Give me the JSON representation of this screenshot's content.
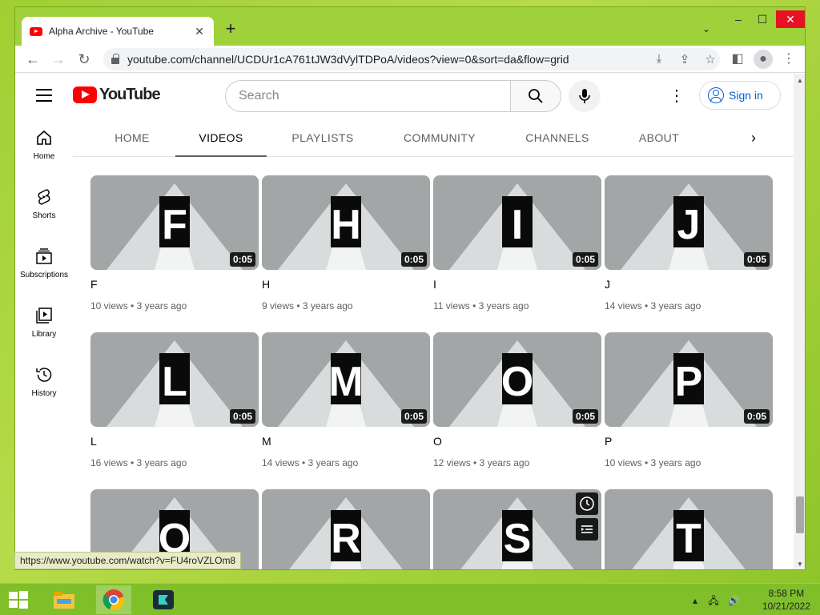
{
  "browser": {
    "tab_title": "Alpha Archive - YouTube",
    "url": "youtube.com/channel/UCDUr1cA761tJW3dVylTDPoA/videos?view=0&sort=da&flow=grid",
    "status_url": "https://www.youtube.com/watch?v=FU4roVZLOm8"
  },
  "youtube": {
    "logo_text": "YouTube",
    "search_placeholder": "Search",
    "sign_in": "Sign in",
    "guide": [
      {
        "label": "Home",
        "icon": "home-icon"
      },
      {
        "label": "Shorts",
        "icon": "shorts-icon"
      },
      {
        "label": "Subscriptions",
        "icon": "subscriptions-icon"
      },
      {
        "label": "Library",
        "icon": "library-icon"
      },
      {
        "label": "History",
        "icon": "history-icon"
      }
    ],
    "tabs": [
      "HOME",
      "VIDEOS",
      "PLAYLISTS",
      "COMMUNITY",
      "CHANNELS",
      "ABOUT"
    ],
    "active_tab": "VIDEOS",
    "videos": [
      {
        "letter": "F",
        "title": "F",
        "duration": "0:05",
        "views": "10 views",
        "age": "3 years ago"
      },
      {
        "letter": "H",
        "title": "H",
        "duration": "0:05",
        "views": "9 views",
        "age": "3 years ago"
      },
      {
        "letter": "I",
        "title": "I",
        "duration": "0:05",
        "views": "11 views",
        "age": "3 years ago"
      },
      {
        "letter": "J",
        "title": "J",
        "duration": "0:05",
        "views": "14 views",
        "age": "3 years ago"
      },
      {
        "letter": "L",
        "title": "L",
        "duration": "0:05",
        "views": "16 views",
        "age": "3 years ago"
      },
      {
        "letter": "M",
        "title": "M",
        "duration": "0:05",
        "views": "14 views",
        "age": "3 years ago"
      },
      {
        "letter": "O",
        "title": "O",
        "duration": "0:05",
        "views": "12 views",
        "age": "3 years ago"
      },
      {
        "letter": "P",
        "title": "P",
        "duration": "0:05",
        "views": "10 views",
        "age": "3 years ago"
      },
      {
        "letter": "Q",
        "title": "",
        "duration": "",
        "views": "",
        "age": ""
      },
      {
        "letter": "R",
        "title": "",
        "duration": "",
        "views": "",
        "age": ""
      },
      {
        "letter": "S",
        "title": "",
        "duration": "",
        "views": "",
        "age": ""
      },
      {
        "letter": "T",
        "title": "",
        "duration": "",
        "views": "",
        "age": ""
      }
    ]
  },
  "taskbar": {
    "time": "8:58 PM",
    "date": "10/21/2022"
  },
  "colors": {
    "yt_red": "#ff0000",
    "link_blue": "#065fd4",
    "desktop_green": "#9fcf33"
  }
}
